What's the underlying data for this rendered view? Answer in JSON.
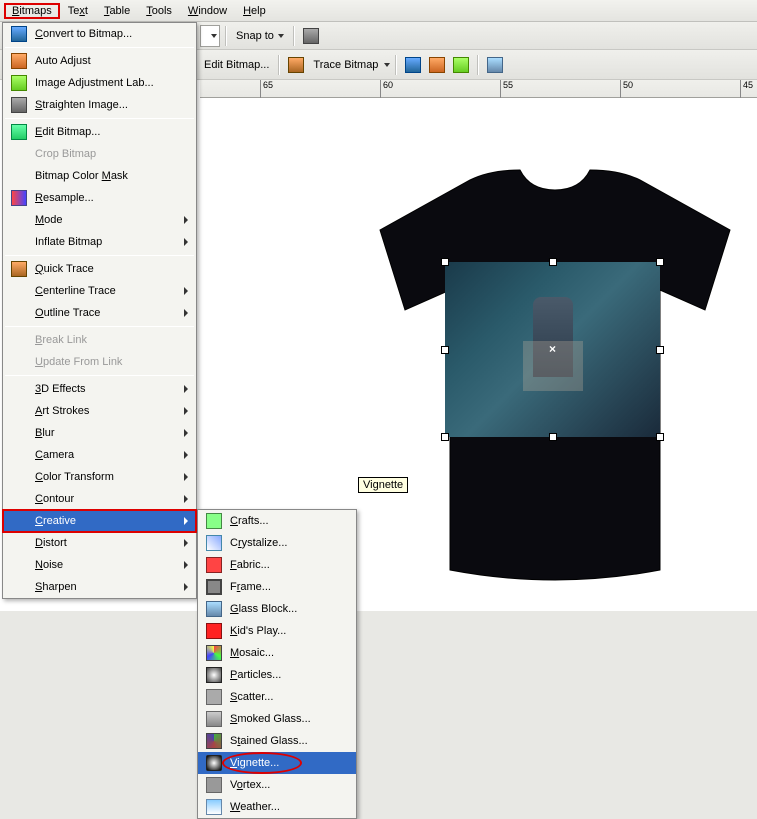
{
  "menubar": {
    "items": [
      {
        "label": "Bitmaps",
        "hotkey": "B",
        "highlighted": true
      },
      {
        "label": "Text",
        "hotkey": "x"
      },
      {
        "label": "Table",
        "hotkey": "T"
      },
      {
        "label": "Tools",
        "hotkey": "T"
      },
      {
        "label": "Window",
        "hotkey": "W"
      },
      {
        "label": "Help",
        "hotkey": "H"
      }
    ]
  },
  "toolbar1": {
    "snap_to": "Snap to"
  },
  "toolbar2": {
    "edit_bitmap": "Edit Bitmap...",
    "trace_bitmap": "Trace Bitmap"
  },
  "ruler": {
    "ticks": [
      "65",
      "60",
      "55",
      "50",
      "45"
    ]
  },
  "bitmaps_menu": {
    "items": [
      {
        "label": "Convert to Bitmap...",
        "u": "C",
        "icon": "bitmap-icon"
      },
      {
        "sep": true
      },
      {
        "label": "Auto Adjust",
        "u": "",
        "icon": "adjust-icon"
      },
      {
        "label": "Image Adjustment Lab...",
        "u": "",
        "icon": "lab-icon"
      },
      {
        "label": "Straighten Image...",
        "u": "S",
        "icon": "straighten-icon"
      },
      {
        "sep": true
      },
      {
        "label": "Edit Bitmap...",
        "u": "E",
        "icon": "edit-icon"
      },
      {
        "label": "Crop Bitmap",
        "u": "",
        "disabled": true
      },
      {
        "label": "Bitmap Color Mask",
        "u": "M"
      },
      {
        "label": "Resample...",
        "u": "R",
        "icon": "resample-icon"
      },
      {
        "label": "Mode",
        "u": "M",
        "arrow": true
      },
      {
        "label": "Inflate Bitmap",
        "u": "",
        "arrow": true
      },
      {
        "sep": true
      },
      {
        "label": "Quick Trace",
        "u": "Q",
        "icon": "trace-icon"
      },
      {
        "label": "Centerline Trace",
        "u": "C",
        "arrow": true
      },
      {
        "label": "Outline Trace",
        "u": "O",
        "arrow": true
      },
      {
        "sep": true
      },
      {
        "label": "Break Link",
        "u": "B",
        "disabled": true
      },
      {
        "label": "Update From Link",
        "u": "U",
        "disabled": true
      },
      {
        "sep": true
      },
      {
        "label": "3D Effects",
        "u": "3",
        "arrow": true
      },
      {
        "label": "Art Strokes",
        "u": "A",
        "arrow": true
      },
      {
        "label": "Blur",
        "u": "B",
        "arrow": true
      },
      {
        "label": "Camera",
        "u": "C",
        "arrow": true
      },
      {
        "label": "Color Transform",
        "u": "C",
        "arrow": true
      },
      {
        "label": "Contour",
        "u": "C",
        "arrow": true
      },
      {
        "label": "Creative",
        "u": "C",
        "arrow": true,
        "highlighted": true,
        "red": true
      },
      {
        "label": "Distort",
        "u": "D",
        "arrow": true
      },
      {
        "label": "Noise",
        "u": "N",
        "arrow": true
      },
      {
        "label": "Sharpen",
        "u": "S",
        "arrow": true
      }
    ]
  },
  "creative_menu": {
    "items": [
      {
        "label": "Crafts...",
        "u": "C",
        "icon": "crafts-icon"
      },
      {
        "label": "Crystalize...",
        "u": "r",
        "icon": "crystal-icon"
      },
      {
        "label": "Fabric...",
        "u": "F",
        "icon": "fabric-icon"
      },
      {
        "label": "Frame...",
        "u": "r",
        "icon": "frame-icon"
      },
      {
        "label": "Glass Block...",
        "u": "G",
        "icon": "glass-icon"
      },
      {
        "label": "Kid's Play...",
        "u": "K",
        "icon": "kids-icon"
      },
      {
        "label": "Mosaic...",
        "u": "M",
        "icon": "mosaic-icon"
      },
      {
        "label": "Particles...",
        "u": "P",
        "icon": "particles-icon"
      },
      {
        "label": "Scatter...",
        "u": "S",
        "icon": "scatter-icon"
      },
      {
        "label": "Smoked Glass...",
        "u": "S",
        "icon": "smoked-icon"
      },
      {
        "label": "Stained Glass...",
        "u": "t",
        "icon": "stained-icon"
      },
      {
        "label": "Vignette...",
        "u": "V",
        "icon": "vignette-icon",
        "highlighted": true,
        "oval": true
      },
      {
        "label": "Vortex...",
        "u": "o",
        "icon": "vortex-icon"
      },
      {
        "label": "Weather...",
        "u": "W",
        "icon": "weather-icon"
      }
    ]
  },
  "tooltip": {
    "text": "Vignette"
  }
}
